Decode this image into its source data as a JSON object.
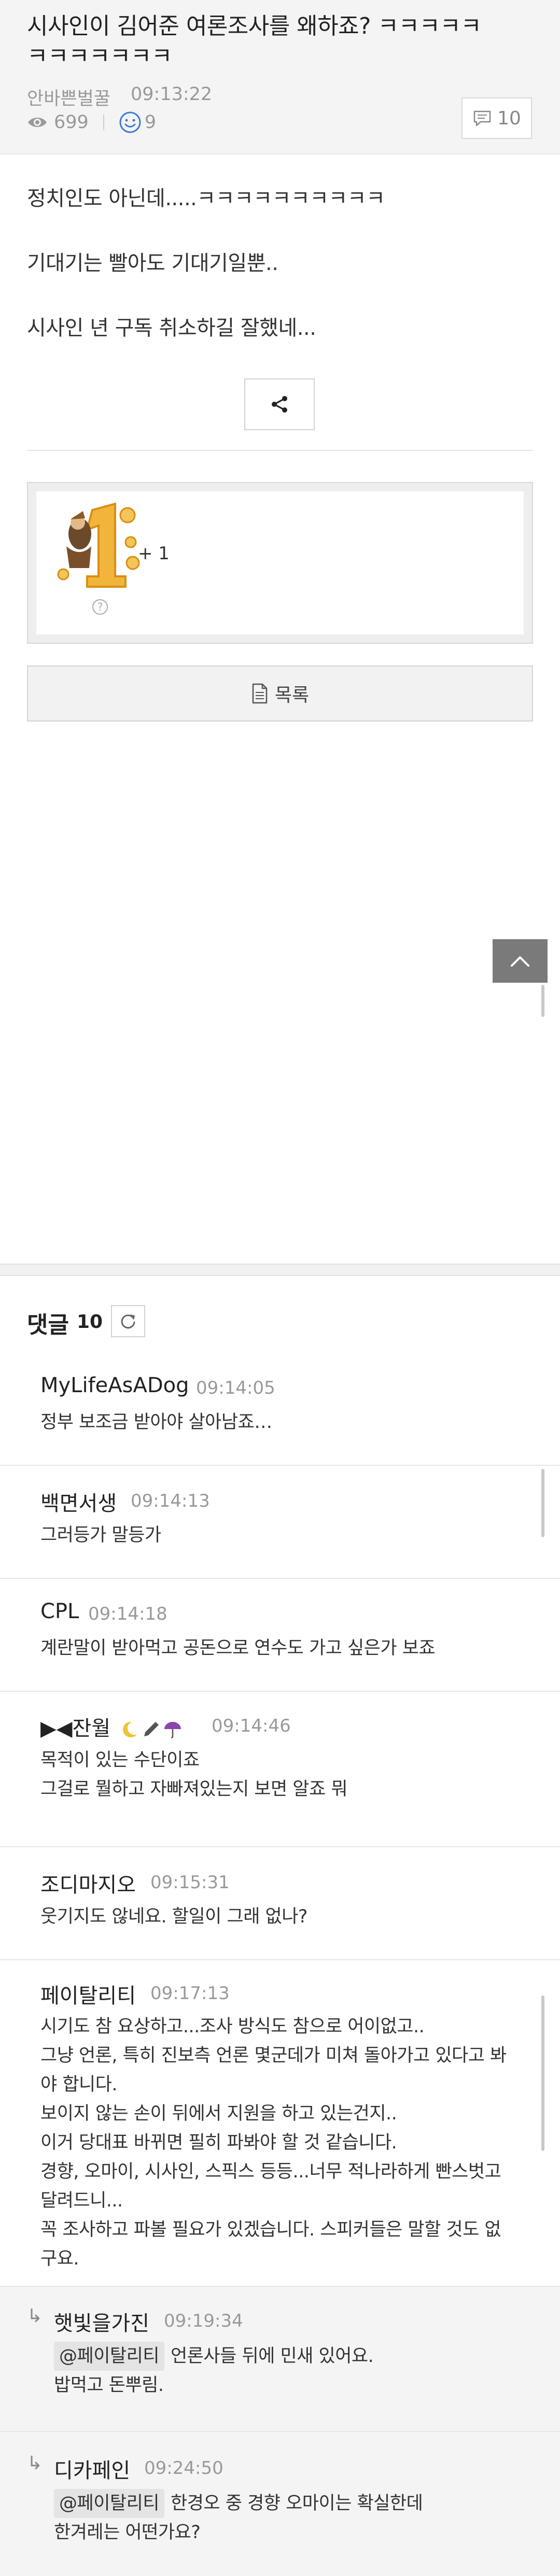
{
  "post": {
    "title": "시사인이 김어준 여론조사를 왜하죠? ㅋㅋㅋㅋㅋㅋㅋㅋㅋㅋㅋㅋ",
    "author": "안바쁜벌꿀",
    "time": "09:13:22",
    "views": "699",
    "likes": "9",
    "comment_count": "10",
    "body_lines": [
      "정치인도 아닌데.....ㅋㅋㅋㅋㅋㅋㅋㅋㅋㅋ",
      "기대기는 빨아도 기대기일뿐..",
      "시사인 년 구독 취소하길 잘했네..."
    ],
    "badge_plus": "+ 1",
    "badge_help": "?",
    "list_button_label": "목록"
  },
  "comments_section": {
    "heading": "댓글",
    "count": "10"
  },
  "comments": [
    {
      "nick": "MyLifeAsADog",
      "time": "09:14:05",
      "lines": [
        "정부 보조금 받아야 살아남죠…"
      ]
    },
    {
      "nick": "백면서생",
      "time": "09:14:13",
      "lines": [
        "그러등가 말등가"
      ]
    },
    {
      "nick": "CPL",
      "time": "09:14:18",
      "lines": [
        "계란말이 받아먹고 공돈으로 연수도 가고 싶은가 보죠"
      ]
    },
    {
      "nick": "▶◀잔월",
      "nick_icons": [
        "moon-icon",
        "pen-icon",
        "umbrella-icon"
      ],
      "time": "09:14:46",
      "lines": [
        "목적이 있는 수단이죠",
        "그걸로 뭘하고 자빠져있는지 보면 알죠 뭐"
      ]
    },
    {
      "nick": "조디마지오",
      "time": "09:15:31",
      "lines": [
        "웃기지도 않네요. 할일이 그래 없나?"
      ]
    },
    {
      "nick": "페이탈리티",
      "time": "09:17:13",
      "lines": [
        "시기도 참 요상하고...조사 방식도 참으로 어이없고..",
        "그냥 언론, 특히 진보측 언론 몇군데가 미쳐 돌아가고 있다고 봐",
        "야 합니다.",
        "보이지 않는 손이 뒤에서 지원을 하고 있는건지..",
        "이거 당대표 바뀌면 필히 파봐야 할 것 같습니다.",
        "경향, 오마이, 시사인, 스픽스 등등...너무 적나라하게 빤스벗고",
        "달려드니...",
        "꼭 조사하고 파볼 필요가 있겠습니다. 스피커들은 말할 것도 없",
        "구요."
      ]
    },
    {
      "nick": "햇빛을가진",
      "time": "09:19:34",
      "reply": true,
      "mention": "@페이탈리티",
      "lines": [
        "언론사들 뒤에 민새 있어요.",
        "밥먹고 돈뿌림."
      ]
    },
    {
      "nick": "디카페인",
      "time": "09:24:50",
      "reply": true,
      "mention": "@페이탈리티",
      "lines": [
        "한경오 중 경향 오마이는 확실한데",
        "한겨레는 어떤가요?"
      ]
    }
  ],
  "colors": {
    "header_bg": "#f4f4f4",
    "reply_bg": "#f4f4f4",
    "accent_blue": "#3a7bd5",
    "top_button_bg": "#7a7a7a"
  },
  "icons": [
    "eye-icon",
    "smile-icon",
    "speech-bubble-icon",
    "share-icon",
    "document-icon",
    "chevron-up-icon",
    "refresh-icon",
    "reply-arrow-icon"
  ]
}
